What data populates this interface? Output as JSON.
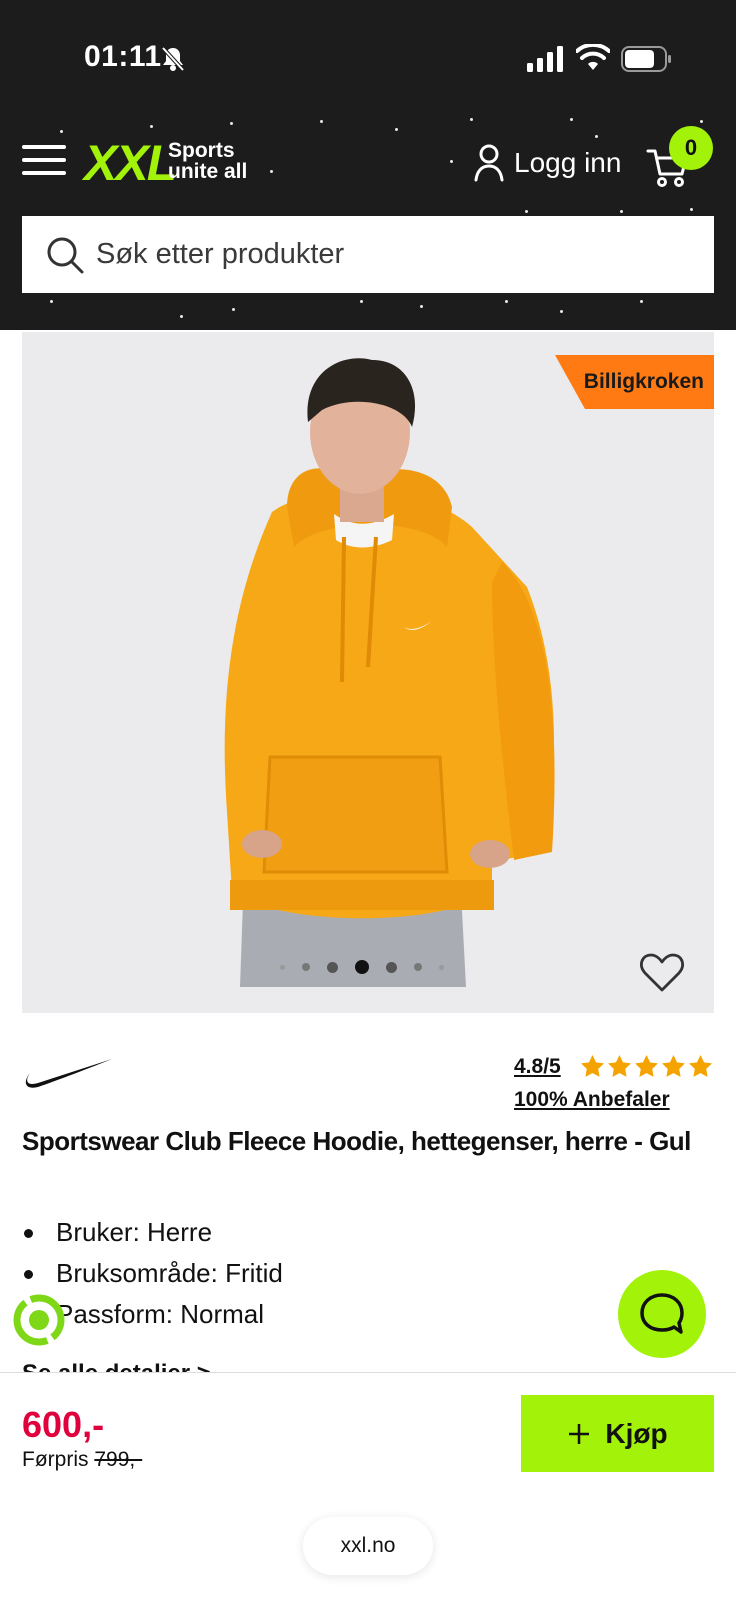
{
  "status_bar": {
    "time": "01:11",
    "icons": [
      "bell-slash-icon",
      "signal-icon",
      "wifi-icon",
      "battery-icon"
    ]
  },
  "header": {
    "logo_text": "XXL",
    "logo_tagline_line1": "Sports",
    "logo_tagline_line2": "unite all",
    "login_label": "Logg inn",
    "cart_count": "0",
    "search_placeholder": "Søk etter produkter",
    "colors": {
      "background": "#1c1c1c",
      "accent": "#a3f20a"
    }
  },
  "product": {
    "promo_badge": "Billigkroken",
    "image_carousel": {
      "total": 7,
      "active_index": 3
    },
    "brand": "Nike",
    "rating": "4.8/5",
    "rating_stars": 5,
    "recommend": "100% Anbefaler",
    "title": "Sportswear Club Fleece Hoodie, hettegenser, herre - Gul",
    "bullets": [
      "Bruker: Herre",
      "Bruksområde: Fritid",
      "Passform: Normal"
    ],
    "details_link": "Se alle detaljer >",
    "price": "600,-",
    "before_price_label": "Førpris",
    "before_price": "799,-",
    "buy_label": "Kjøp",
    "colors": {
      "price": "#e0003c",
      "promo": "#ff7a12",
      "star": "#f4a300"
    }
  },
  "browser": {
    "url": "xxl.no"
  }
}
